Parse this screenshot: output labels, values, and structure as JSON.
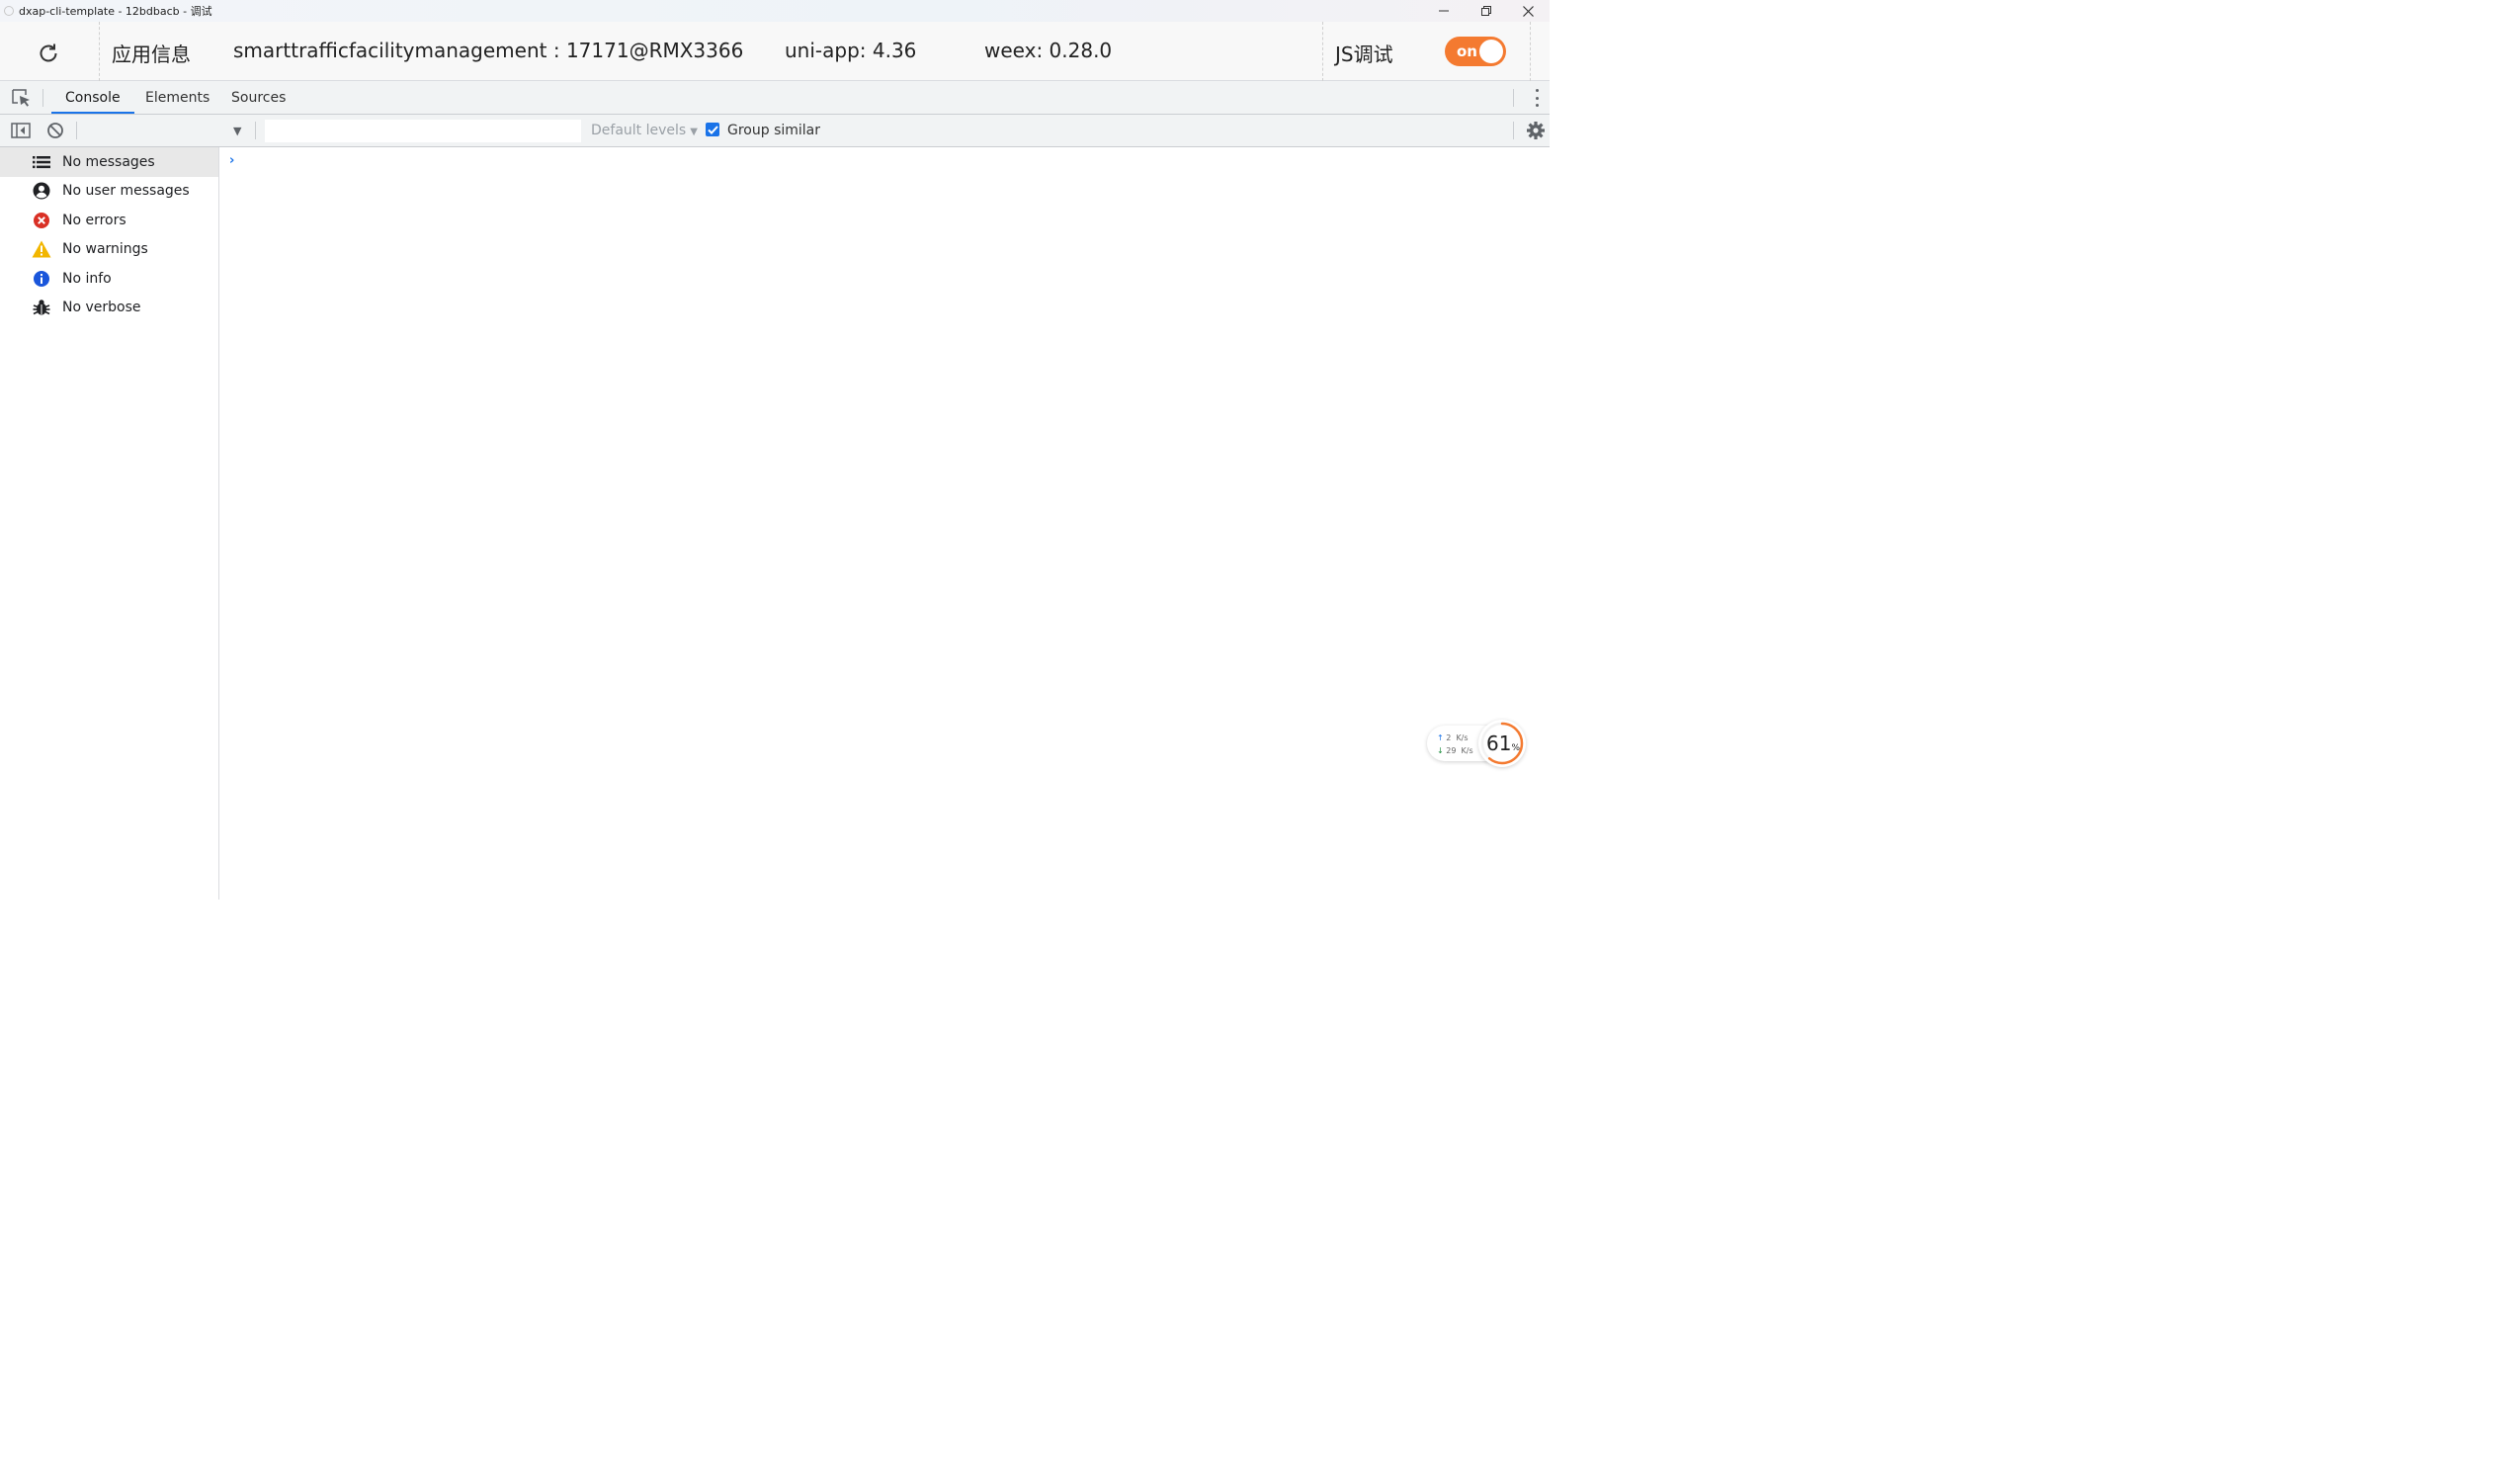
{
  "window": {
    "title": "dxap-cli-template - 12bdbacb - 调试"
  },
  "info_bar": {
    "section_label": "应用信息",
    "device": "smarttrafficfacilitymanagement : 17171@RMX3366",
    "uni_app_version": "uni-app: 4.36",
    "weex_version": "weex: 0.28.0",
    "js_debug_label": "JS调试",
    "js_debug_toggle": "on"
  },
  "devtools": {
    "tabs": [
      {
        "label": "Console",
        "active": true
      },
      {
        "label": "Elements",
        "active": false
      },
      {
        "label": "Sources",
        "active": false
      }
    ]
  },
  "toolbar": {
    "filter_value": "",
    "levels_label": "Default levels",
    "group_similar_label": "Group similar",
    "group_similar_checked": true
  },
  "sidebar": {
    "items": [
      {
        "label": "No messages",
        "icon": "list-icon",
        "selected": true
      },
      {
        "label": "No user messages",
        "icon": "user-icon",
        "selected": false
      },
      {
        "label": "No errors",
        "icon": "error-icon",
        "selected": false
      },
      {
        "label": "No warnings",
        "icon": "warning-icon",
        "selected": false
      },
      {
        "label": "No info",
        "icon": "info-icon",
        "selected": false
      },
      {
        "label": "No verbose",
        "icon": "bug-icon",
        "selected": false
      }
    ]
  },
  "console": {
    "prompt": "›"
  },
  "network_widget": {
    "upload_value": "2",
    "upload_unit": "K/s",
    "download_value": "29",
    "download_unit": "K/s",
    "percent_value": "61",
    "percent_sign": "%",
    "percent_fraction": 0.61
  },
  "colors": {
    "accent": "#1a73e8",
    "toggle_on": "#f47a30",
    "error": "#d93025",
    "warning": "#f2b600",
    "info": "#1a73e8",
    "ring": "#f47a30"
  }
}
